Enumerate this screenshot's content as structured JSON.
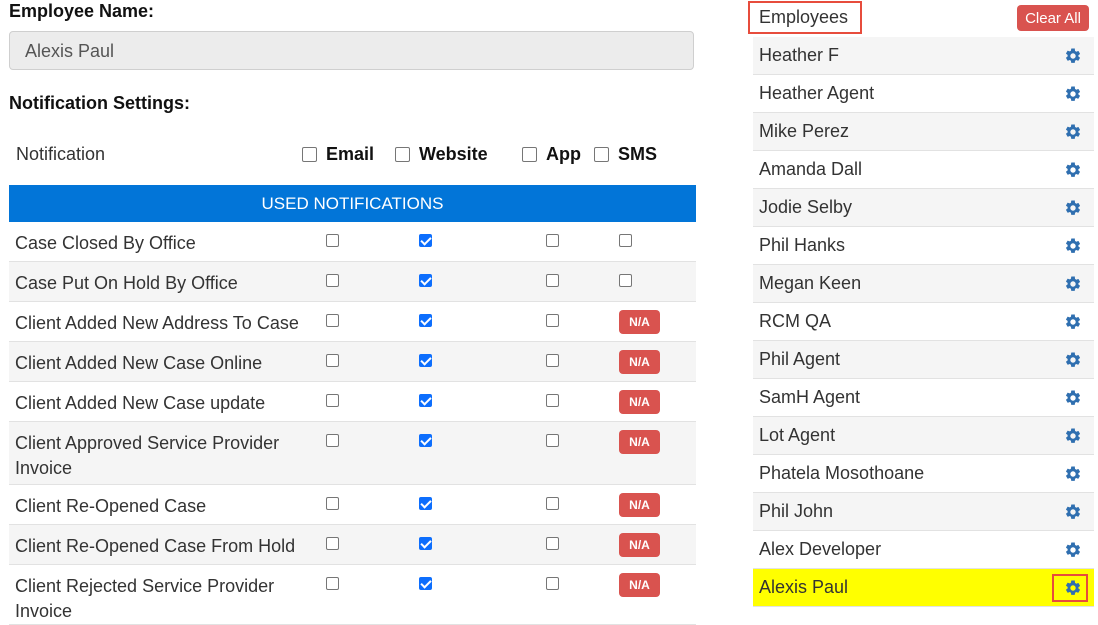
{
  "employee_name_label": "Employee Name:",
  "employee_name_value": "Alexis   Paul",
  "notification_settings_label": "Notification Settings:",
  "header": {
    "notification_label": "Notification",
    "email_label": "Email",
    "website_label": "Website",
    "app_label": "App",
    "sms_label": "SMS"
  },
  "used_notifications_title": "USED NOTIFICATIONS",
  "na_label": "N/A",
  "notifications": [
    {
      "name": "Case Closed By Office",
      "email": false,
      "website": true,
      "app": false,
      "sms": "unchecked"
    },
    {
      "name": "Case Put On Hold By Office",
      "email": false,
      "website": true,
      "app": false,
      "sms": "unchecked"
    },
    {
      "name": "Client Added New Address To Case",
      "email": false,
      "website": true,
      "app": false,
      "sms": "na"
    },
    {
      "name": "Client Added New Case Online",
      "email": false,
      "website": true,
      "app": false,
      "sms": "na"
    },
    {
      "name": "Client Added New Case update",
      "email": false,
      "website": true,
      "app": false,
      "sms": "na"
    },
    {
      "name": "Client Approved Service Provider Invoice",
      "email": false,
      "website": true,
      "app": false,
      "sms": "na"
    },
    {
      "name": "Client Re-Opened Case",
      "email": false,
      "website": true,
      "app": false,
      "sms": "na"
    },
    {
      "name": "Client Re-Opened Case From Hold",
      "email": false,
      "website": true,
      "app": false,
      "sms": "na"
    },
    {
      "name": "Client Rejected Service Provider Invoice",
      "email": false,
      "website": true,
      "app": false,
      "sms": "na"
    }
  ],
  "employees_title": "Employees",
  "clear_all_label": "Clear All",
  "employees": [
    "Heather F",
    "Heather Agent",
    "Mike Perez",
    "Amanda Dall",
    "Jodie Selby",
    "Phil Hanks",
    "Megan Keen",
    "RCM QA",
    "Phil Agent",
    "SamH Agent",
    "Lot Agent",
    "Phatela Mosothoane",
    "Phil John",
    "Alex Developer",
    "Alexis Paul"
  ],
  "selected_employee": "Alexis Paul",
  "colors": {
    "primary_bar": "#0275d8",
    "danger": "#d9534f",
    "highlight": "#ffff00",
    "gear": "#2f6fb0"
  },
  "icons": {
    "gear": "gear-icon"
  }
}
